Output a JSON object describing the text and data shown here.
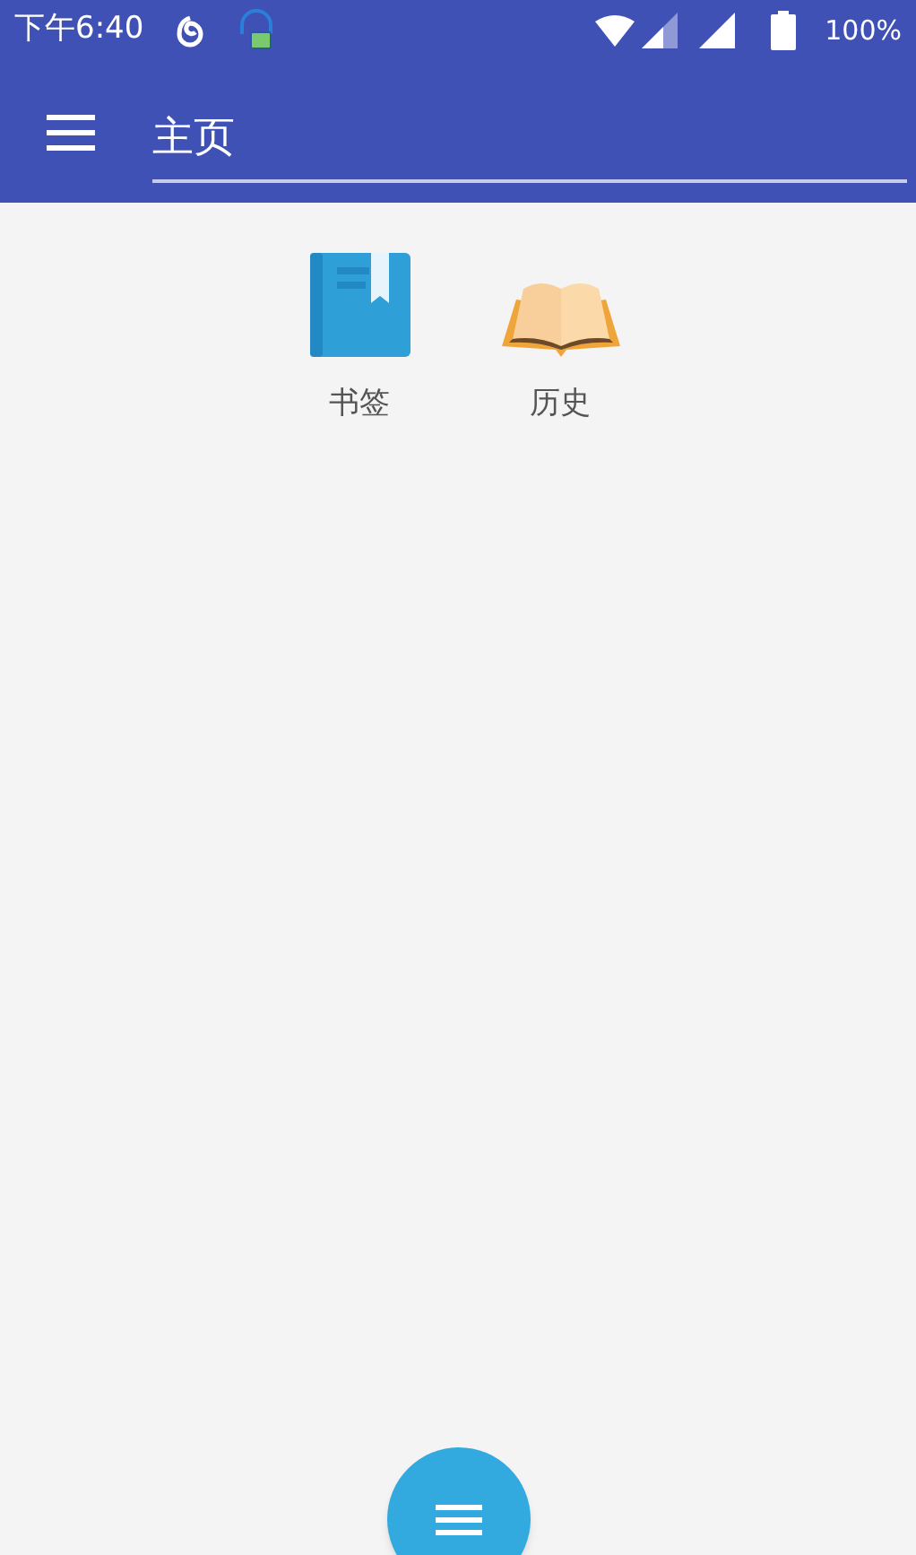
{
  "status_bar": {
    "time": "下午6:40",
    "battery": "100%"
  },
  "toolbar": {
    "title": "主页"
  },
  "shortcuts": [
    {
      "kind": "bookmark",
      "label": "书签"
    },
    {
      "kind": "history",
      "label": "历史"
    }
  ]
}
